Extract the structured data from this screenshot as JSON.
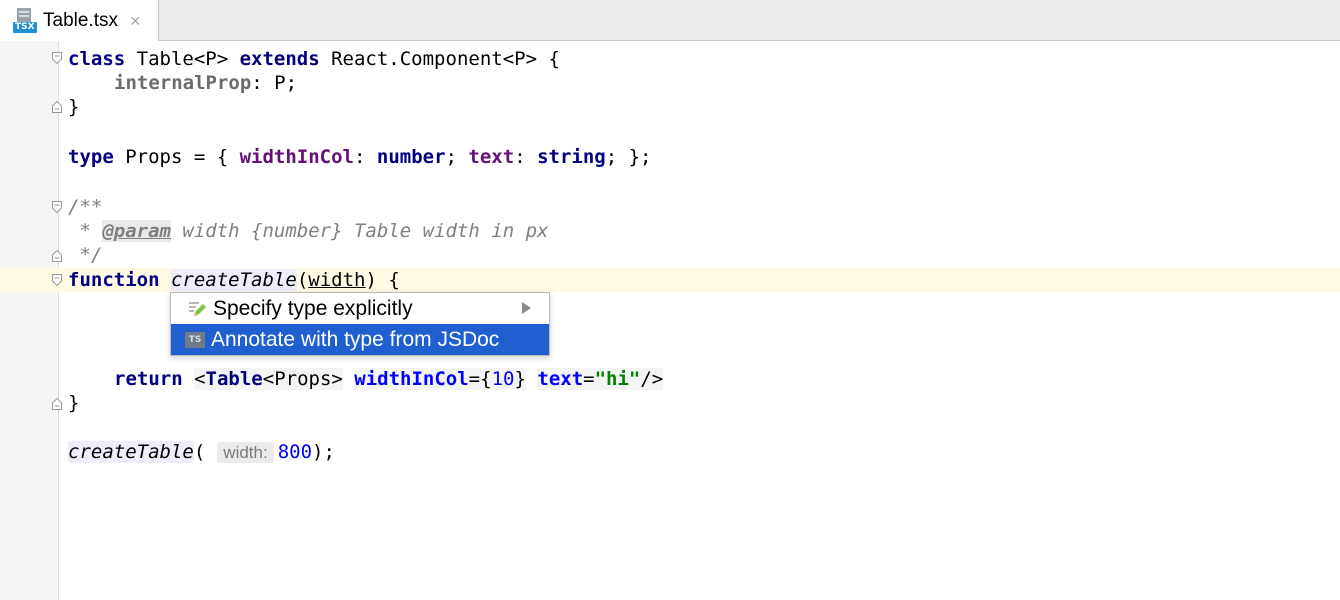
{
  "tab": {
    "label": "Table.tsx",
    "icon_badge": "TSX",
    "close_glyph": "×"
  },
  "editor": {
    "line1": {
      "kw": "class",
      "name": " Table<P> ",
      "kw2": "extends",
      "rest": " React.Component<P> {"
    },
    "line2": {
      "field": "internalProp",
      "rest": ": P;"
    },
    "line3": "}",
    "line4": {
      "kw": "type",
      "name": " Props = { ",
      "f1": "widthInCol",
      "c1": ": ",
      "t1": "number",
      "s1": "; ",
      "f2": "text",
      "c2": ": ",
      "t2": "string",
      "end": "; };"
    },
    "line5": "/**",
    "line6": {
      "pre": " * ",
      "tag": "@param",
      "rest": " width {number} Table width in px"
    },
    "line7": " */",
    "line8": {
      "kw": "function",
      "space": " ",
      "fn": "createTable",
      "open": "(",
      "param": "width",
      "close": ") {"
    },
    "line9": {
      "kw": "return",
      "space": " ",
      "lt": "<",
      "tag": "Table",
      "generic": "<Props>",
      "sp1": " ",
      "attr1": "widthInCol",
      "eq1": "=",
      "val1_open": "{",
      "val1": "10",
      "val1_close": "}",
      "sp2": " ",
      "attr2": "text",
      "eq2": "=",
      "val2": "\"hi\"",
      "end": "/>"
    },
    "line10": "}",
    "line11": {
      "fn": "createTable",
      "open": "(",
      "hint": "width:",
      "num": "800",
      "end": ");"
    }
  },
  "popup": {
    "items": [
      {
        "label": "Specify type explicitly",
        "icon": "pencil-icon",
        "has_submenu": true
      },
      {
        "label": "Annotate with type from JSDoc",
        "icon": "ts-icon",
        "icon_text": "TS",
        "selected": true
      }
    ]
  },
  "colors": {
    "keyword": "#000080",
    "field": "#660e7a",
    "number": "#0000ff",
    "string": "#008000",
    "comment": "#808080",
    "selection": "#1f5fd0",
    "caret_row": "#fffae3"
  }
}
